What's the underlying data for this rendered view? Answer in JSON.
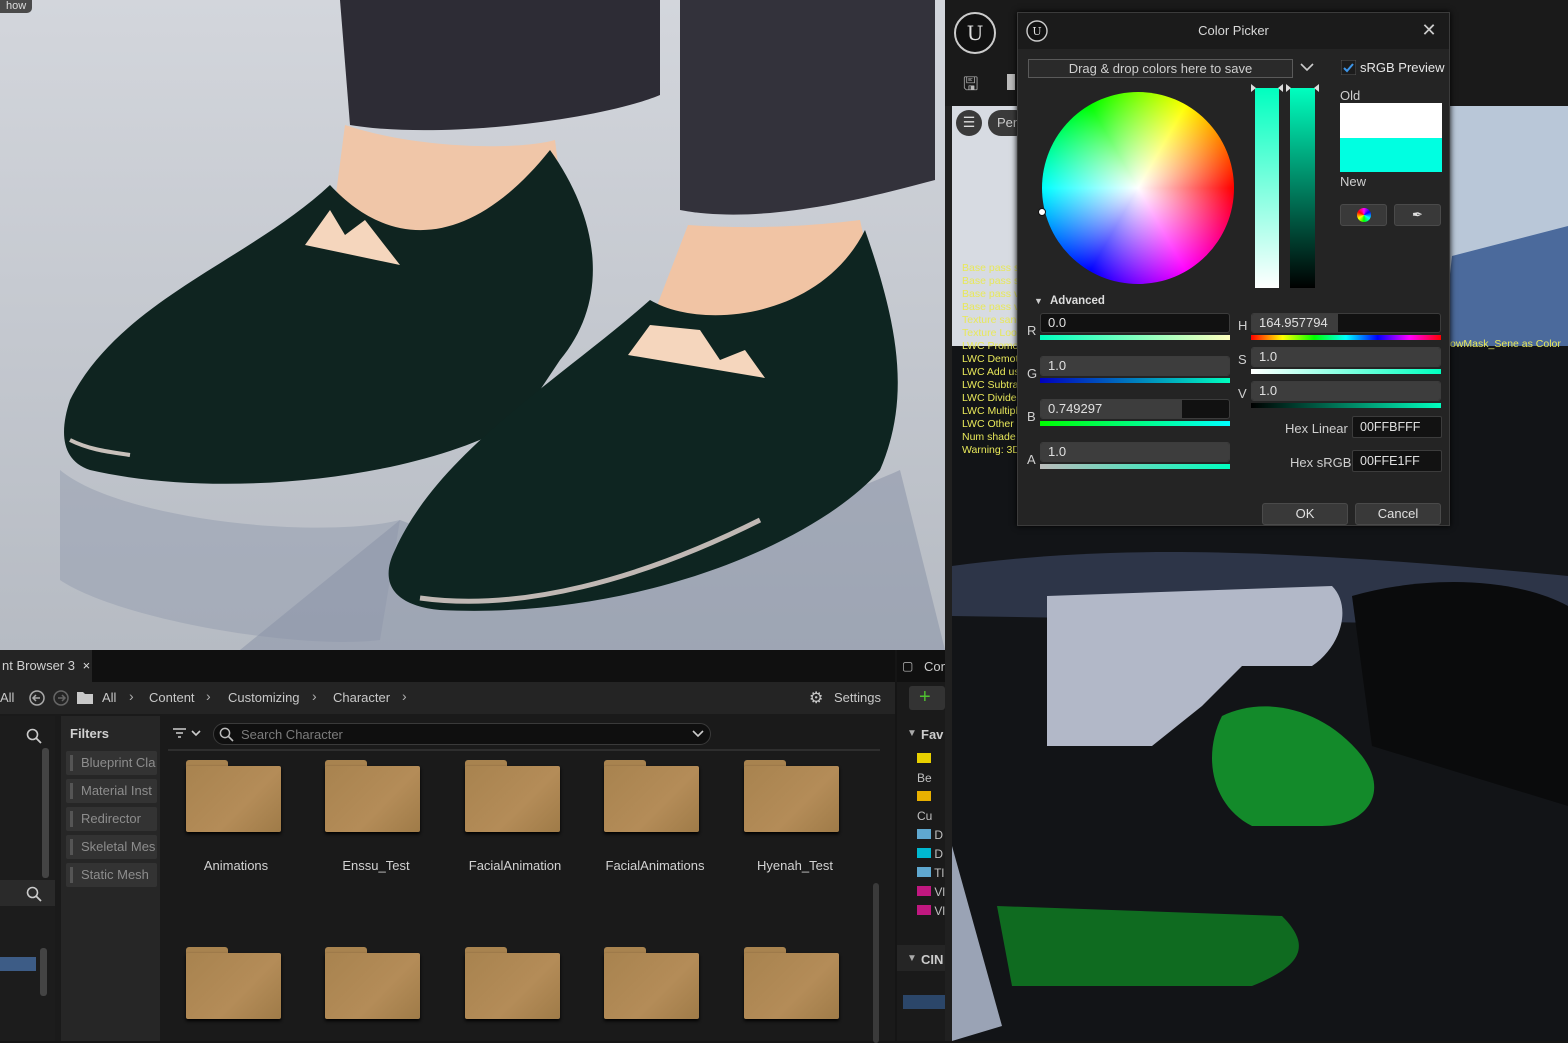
{
  "viewport_left": {
    "show_label": "how"
  },
  "content_browser": {
    "tab_label": "nt Browser 3",
    "tab_close": "×",
    "all_label": "All",
    "breadcrumbs": [
      "All",
      "Content",
      "Customizing",
      "Character"
    ],
    "settings_label": "Settings",
    "filters_title": "Filters",
    "filters": [
      "Blueprint Cla",
      "Material Inst",
      "Redirector",
      "Skeletal Mes",
      "Static Mesh"
    ],
    "search_placeholder": "Search Character",
    "folders_row1": [
      "Animations",
      "Enssu_Test",
      "FacialAnimation",
      "FacialAnimations",
      "Hyenah_Test"
    ]
  },
  "right_panel": {
    "perf_btn": "Per",
    "content_tab": "Con",
    "fav_label": "Fav",
    "cin_label": "CIN",
    "tree_items": [
      "Be",
      "Cu",
      "D",
      "D",
      "Tl",
      "Vl",
      "Vl"
    ],
    "tree_colors": [
      "#e8d000",
      "#e8b000",
      "#5fa8d0",
      "#00b8d0",
      "#5fa8d0",
      "#c01880",
      "#c01880"
    ],
    "stats_lines": [
      "Base pass s",
      "Base pass s",
      "Base pass v",
      "Base pass v",
      "Texture san",
      "Texture Loo",
      "LWC Promo",
      "LWC Demot",
      "LWC Add us",
      "LWC Subtra",
      "LWC Divide",
      "LWC Multipl",
      "LWC Other",
      "Num shade",
      "Warning: 3D"
    ],
    "warning_tail": "owMask_Sene as Color"
  },
  "color_picker": {
    "title": "Color Picker",
    "close": "✕",
    "drag_drop": "Drag & drop colors here to save",
    "srgb_preview": "sRGB Preview",
    "old_label": "Old",
    "new_label": "New",
    "old_color": "#ffffff",
    "new_color": "#00ffe1",
    "advanced": "Advanced",
    "r_label": "R",
    "r_value": "0.0",
    "g_label": "G",
    "g_value": "1.0",
    "b_label": "B",
    "b_value": "0.749297",
    "a_label": "A",
    "a_value": "1.0",
    "h_label": "H",
    "h_value": "164.957794",
    "s_label": "S",
    "s_value": "1.0",
    "v_label": "V",
    "v_value": "1.0",
    "hex_linear_label": "Hex Linear",
    "hex_linear": "00FFBFFF",
    "hex_srgb_label": "Hex sRGB",
    "hex_srgb": "00FFE1FF",
    "ok": "OK",
    "cancel": "Cancel"
  }
}
